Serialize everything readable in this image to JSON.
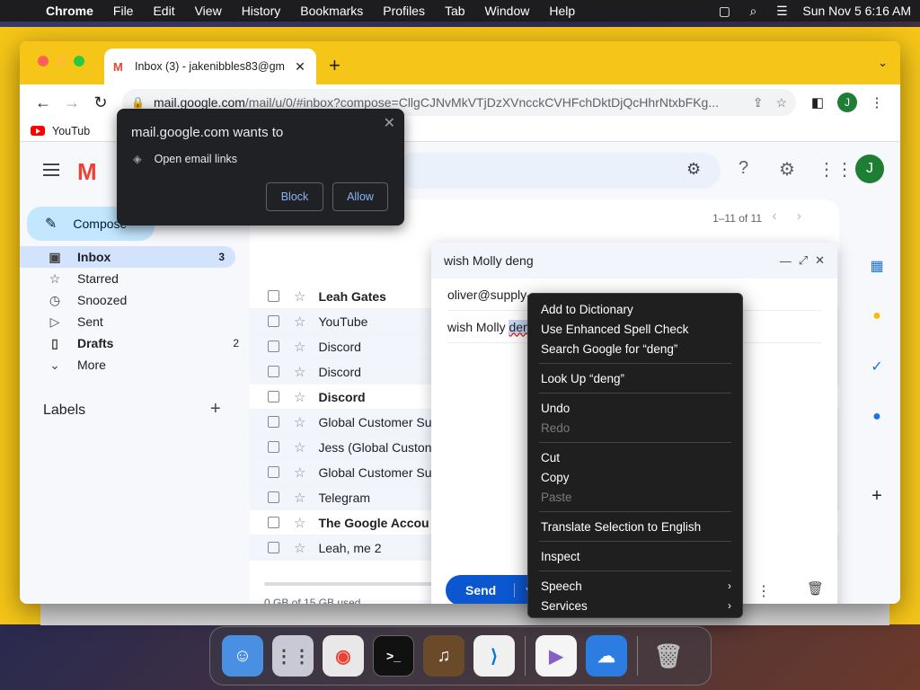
{
  "menubar": {
    "app": "Chrome",
    "items": [
      "File",
      "Edit",
      "View",
      "History",
      "Bookmarks",
      "Profiles",
      "Tab",
      "Window",
      "Help"
    ],
    "datetime": "Sun Nov 5  6:16 AM"
  },
  "browser": {
    "tab_title": "Inbox (3) - jakenibbles83@gm",
    "url_host": "mail.google.com",
    "url_path": "/mail/u/0/#inbox?compose=CllgCJNvMkVTjDzXVncckCVHFchDktDjQcHhrNtxbFKg...",
    "profile_initial": "J",
    "bookmark": "YouTub"
  },
  "permission": {
    "title": "mail.google.com wants to",
    "request": "Open email links",
    "block": "Block",
    "allow": "Allow"
  },
  "gmail": {
    "compose": "Compose",
    "nav": [
      {
        "label": "Inbox",
        "count": "3"
      },
      {
        "label": "Starred",
        "count": ""
      },
      {
        "label": "Snoozed",
        "count": ""
      },
      {
        "label": "Sent",
        "count": ""
      },
      {
        "label": "Drafts",
        "count": "2"
      },
      {
        "label": "More",
        "count": ""
      }
    ],
    "labels_heading": "Labels",
    "pager": "1–11 of 11",
    "avatar": "J",
    "rows": [
      {
        "sender": "Leah Gates",
        "unread": true
      },
      {
        "sender": "YouTube",
        "unread": false
      },
      {
        "sender": "Discord",
        "unread": false
      },
      {
        "sender": "Discord",
        "unread": false
      },
      {
        "sender": "Discord",
        "unread": true
      },
      {
        "sender": "Global Customer Su",
        "unread": false
      },
      {
        "sender": "Jess (Global Custon",
        "unread": false
      },
      {
        "sender": "Global Customer Su",
        "unread": false
      },
      {
        "sender": "Telegram",
        "unread": false
      },
      {
        "sender": "The Google Accou",
        "unread": true
      },
      {
        "sender": "Leah, me 2",
        "unread": false
      }
    ],
    "storage": "0 GB of 15 GB used"
  },
  "compose_window": {
    "title": "wish Molly deng",
    "to": "oliver@supply-",
    "subject_prefix": "wish Molly ",
    "subject_selected": "den",
    "send": "Send"
  },
  "context_menu": {
    "add_dict": "Add to Dictionary",
    "enhanced": "Use Enhanced Spell Check",
    "search": "Search Google for “deng”",
    "lookup": "Look Up “deng”",
    "undo": "Undo",
    "redo": "Redo",
    "cut": "Cut",
    "copy": "Copy",
    "paste": "Paste",
    "translate": "Translate Selection to English",
    "inspect": "Inspect",
    "speech": "Speech",
    "services": "Services"
  },
  "colors": {
    "window_accent": "#f5c518",
    "compose_button": "#c2e7ff",
    "send_button": "#0b57d0"
  }
}
